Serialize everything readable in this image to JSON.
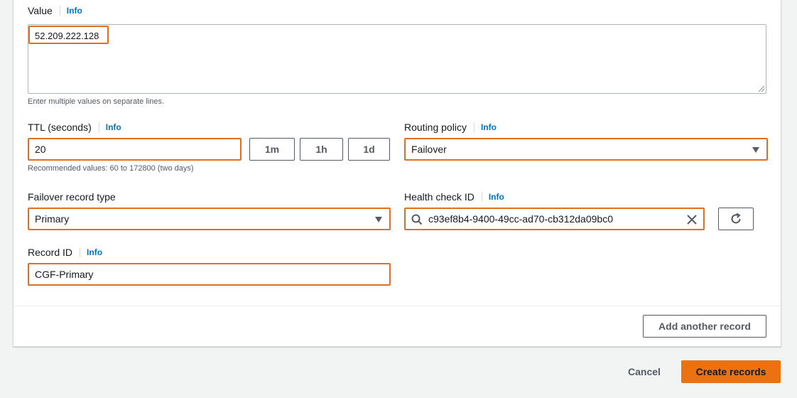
{
  "value_field": {
    "label": "Value",
    "info": "Info",
    "value": "52.209.222.128",
    "hint": "Enter multiple values on separate lines."
  },
  "ttl_field": {
    "label": "TTL (seconds)",
    "info": "Info",
    "value": "20",
    "presets": [
      "1m",
      "1h",
      "1d"
    ],
    "hint": "Recommended values: 60 to 172800 (two days)"
  },
  "routing_policy": {
    "label": "Routing policy",
    "info": "Info",
    "selected": "Failover"
  },
  "failover_record_type": {
    "label": "Failover record type",
    "selected": "Primary"
  },
  "health_check": {
    "label": "Health check ID",
    "info": "Info",
    "value": "c93ef8b4-9400-49cc-ad70-cb312da09bc0"
  },
  "record_id": {
    "label": "Record ID",
    "info": "Info",
    "value": "CGF-Primary"
  },
  "actions": {
    "add_another": "Add another record",
    "cancel": "Cancel",
    "create": "Create records"
  },
  "colors": {
    "highlight": "#e07020",
    "primary_button": "#ec7211",
    "info_link": "#0073bb"
  },
  "icons": [
    "search-icon",
    "clear-icon",
    "refresh-icon",
    "caret-down-icon"
  ]
}
